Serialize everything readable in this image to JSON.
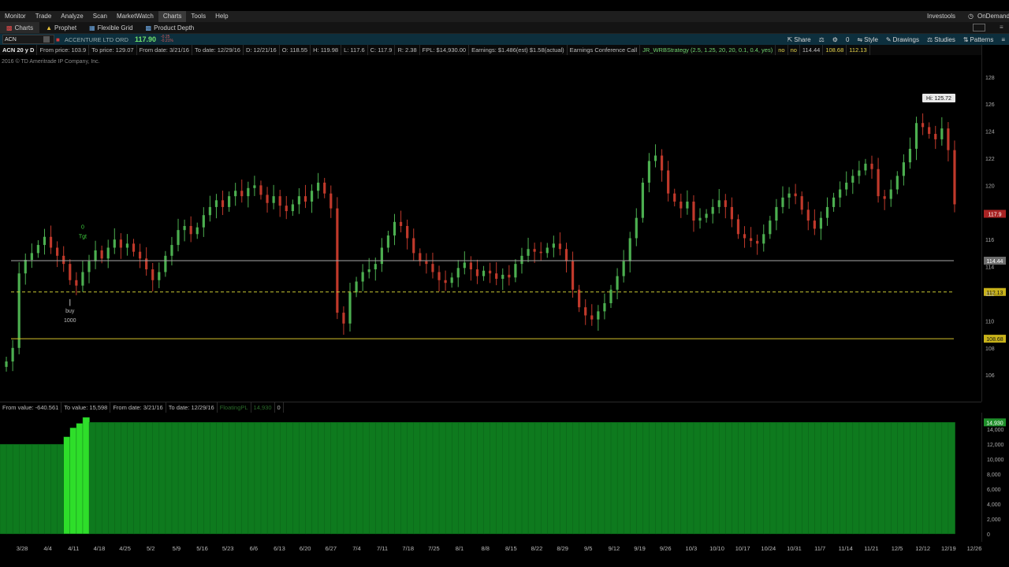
{
  "menu": {
    "items": [
      "Monitor",
      "Trade",
      "Analyze",
      "Scan",
      "MarketWatch",
      "Charts",
      "Tools",
      "Help"
    ],
    "active_index": 5,
    "investools": "Investools",
    "ondemand": "OnDemand"
  },
  "tabs": [
    {
      "label": "Charts",
      "icon": "chart-icon",
      "color": "#e24a4a"
    },
    {
      "label": "Prophet",
      "icon": "warning-icon",
      "color": "#e8c23a"
    },
    {
      "label": "Flexible Grid",
      "icon": "grid-icon",
      "color": "#6aa6e0"
    },
    {
      "label": "Product Depth",
      "icon": "depth-icon",
      "color": "#6aa6e0"
    }
  ],
  "toolbar": {
    "symbol": "ACN",
    "company": "ACCENTURE LTD ORD",
    "price": "117.90",
    "change": "-0.25",
    "change_pct": "-0.21%",
    "share": "Share",
    "zero": "0",
    "style": "Style",
    "drawings": "Drawings",
    "studies": "Studies",
    "patterns": "Patterns"
  },
  "info": {
    "period": "ACN 20 y D",
    "from_price": "From price: 103.9",
    "to_price": "To price: 129.07",
    "from_date": "From date: 3/21/16",
    "to_date": "To date: 12/29/16",
    "d": "D: 12/21/16",
    "o": "O: 118.55",
    "h": "H: 119.98",
    "l": "L: 117.6",
    "c": "C: 117.9",
    "r": "R: 2.38",
    "fpl": "FPL: $14,930.00",
    "earnings": "Earnings: $1.486(est) $1.58(actual)",
    "conf_call": "Earnings Conference Call",
    "strategy": "JR_WRBStrategy (2.5, 1.25, 20, 20, 0.1, 0.4, yes)",
    "no1": "no",
    "no2": "no",
    "v1": "114.44",
    "v2": "108.68",
    "v3": "112.13"
  },
  "copyright": "2016 © TD Ameritrade IP Company, Inc.",
  "lower_header": {
    "from_value": "From value: -640.561",
    "to_value": "To value: 15,598",
    "from_date": "From date: 3/21/16",
    "to_date": "To date: 12/29/16",
    "floating": "FloatingPL",
    "floating_val": "14,930",
    "zero": "0"
  },
  "colors": {
    "up": "#4caf50",
    "down": "#c0392b",
    "line_white": "#a8a8a8",
    "line_yellow_dash": "#c8c832",
    "line_yellow": "#d4c22a",
    "bar_green": "#0e7a1e",
    "bar_bright": "#2ede2a"
  },
  "chart_data": [
    {
      "type": "candlestick",
      "title": "",
      "y_ticks": [
        106,
        108,
        110,
        112,
        114,
        116,
        118,
        120,
        122,
        124,
        126,
        128
      ],
      "ylim": [
        104.5,
        128.8
      ],
      "x_ticks": [
        "3/28",
        "4/4",
        "4/11",
        "4/18",
        "4/25",
        "5/2",
        "5/9",
        "5/16",
        "5/23",
        "6/6",
        "6/13",
        "6/20",
        "6/27",
        "7/4",
        "7/11",
        "7/18",
        "7/25",
        "8/1",
        "8/8",
        "8/15",
        "8/22",
        "8/29",
        "9/5",
        "9/12",
        "9/19",
        "9/26",
        "10/3",
        "10/10",
        "10/17",
        "10/24",
        "10/31",
        "11/7",
        "11/14",
        "11/21",
        "12/5",
        "12/12",
        "12/19",
        "12/26"
      ],
      "hi_label": "Hi: 125.72",
      "last_price": "117.9",
      "hlines": [
        {
          "value": 114.44,
          "label": "114.44",
          "style": "solid-white"
        },
        {
          "value": 112.13,
          "label": "112.13",
          "style": "dashed-yellow"
        },
        {
          "value": 108.68,
          "label": "108.68",
          "style": "solid-yellow"
        }
      ],
      "annotations": [
        {
          "text": "0",
          "date_index": 12,
          "value": 116.8
        },
        {
          "text": "Tgt",
          "date_index": 12,
          "value": 116.1
        },
        {
          "text": "buy",
          "date_index": 10,
          "value": 110.6
        },
        {
          "text": "1000",
          "date_index": 10,
          "value": 109.9
        }
      ],
      "closes": [
        107,
        108,
        113.5,
        114.5,
        115,
        115.6,
        116.2,
        115.4,
        114.8,
        114.2,
        113,
        112.6,
        113.6,
        114.4,
        115.2,
        114.6,
        115.4,
        116,
        115.4,
        115.7,
        115.1,
        114.6,
        113.8,
        113,
        113.6,
        114.8,
        115.6,
        116.7,
        117,
        116.4,
        116.9,
        117.8,
        118.4,
        118.9,
        118.4,
        119.2,
        119.6,
        119.2,
        119.8,
        120,
        119.3,
        118.7,
        119.2,
        118.5,
        118.1,
        118.6,
        119.2,
        118.8,
        119.6,
        120.2,
        119.4,
        118.3,
        110.6,
        109.8,
        112.1,
        112.9,
        113.6,
        113.8,
        114.2,
        115.4,
        116.3,
        117.3,
        117,
        116.1,
        115,
        114.4,
        114.2,
        113.6,
        113,
        112.8,
        113.2,
        113.9,
        114.3,
        113.8,
        113.3,
        113.7,
        113.5,
        113.1,
        113.4,
        113.2,
        114.2,
        114.8,
        115.3,
        115.1,
        115,
        115.4,
        115.7,
        115.3,
        114.4,
        112.3,
        111,
        110.4,
        110.1,
        110.7,
        111.3,
        112.3,
        113.3,
        114.4,
        116.1,
        117.6,
        120.2,
        121.8,
        122.2,
        121.1,
        119.4,
        118.8,
        118.3,
        118.8,
        117.4,
        117.6,
        117.9,
        118.4,
        118.9,
        118.4,
        117.5,
        116.4,
        116.1,
        115.9,
        115.7,
        116.4,
        117.4,
        118.4,
        119.1,
        119.4,
        119.2,
        118.2,
        117.4,
        116.8,
        117.6,
        118.4,
        119.1,
        119.7,
        120.2,
        120.7,
        121.1,
        121.6,
        121.2,
        119.2,
        119,
        119.7,
        120.7,
        121.7,
        122.7,
        124.6,
        124.3,
        123.8,
        123.4,
        124.2,
        122.6,
        118.6
      ]
    },
    {
      "type": "bar",
      "title": "",
      "series_name": "FloatingPL",
      "y_ticks": [
        0,
        2000,
        4000,
        6000,
        8000,
        10000,
        12000,
        14000
      ],
      "ylim": [
        -640.561,
        15598
      ],
      "last_value": "14,930",
      "flat_value": 12000,
      "plateau_value": 14930,
      "bright_start_index": 10,
      "bright_end_index": 13,
      "bright_values": [
        13000,
        14200,
        14800,
        15600
      ]
    }
  ]
}
